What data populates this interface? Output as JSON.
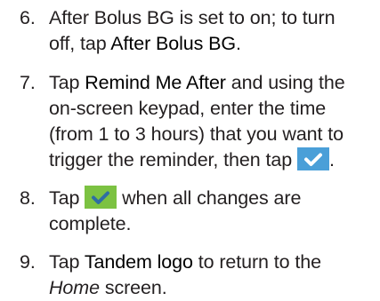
{
  "steps": [
    {
      "number": "6.",
      "line1_pre": "After Bolus BG is set to on; to turn",
      "line2_pre": "off, tap ",
      "line2_term": "After Bolus BG",
      "line2_post": "."
    },
    {
      "number": "7.",
      "line1_pre": "Tap ",
      "line1_term": "Remind Me After",
      "line1_post": " and using the",
      "line2": "on-screen keypad, enter the time",
      "line3": "(from 1 to 3 hours) that you want to",
      "line4_pre": "trigger the reminder, then tap ",
      "line4_icon": "checkmark-blue-icon",
      "line4_post": "."
    },
    {
      "number": "8.",
      "line1_pre": "Tap ",
      "line1_icon": "checkmark-green-icon",
      "line1_post": " when all changes are",
      "line2": "complete."
    },
    {
      "number": "9.",
      "line1_pre": "Tap ",
      "line1_term": "Tandem logo",
      "line1_post": " to return to the",
      "line2_em": "Home",
      "line2_post": " screen."
    }
  ],
  "colors": {
    "text": "#231f20",
    "check_blue": "#4a9fd8",
    "check_green": "#7cc242"
  }
}
